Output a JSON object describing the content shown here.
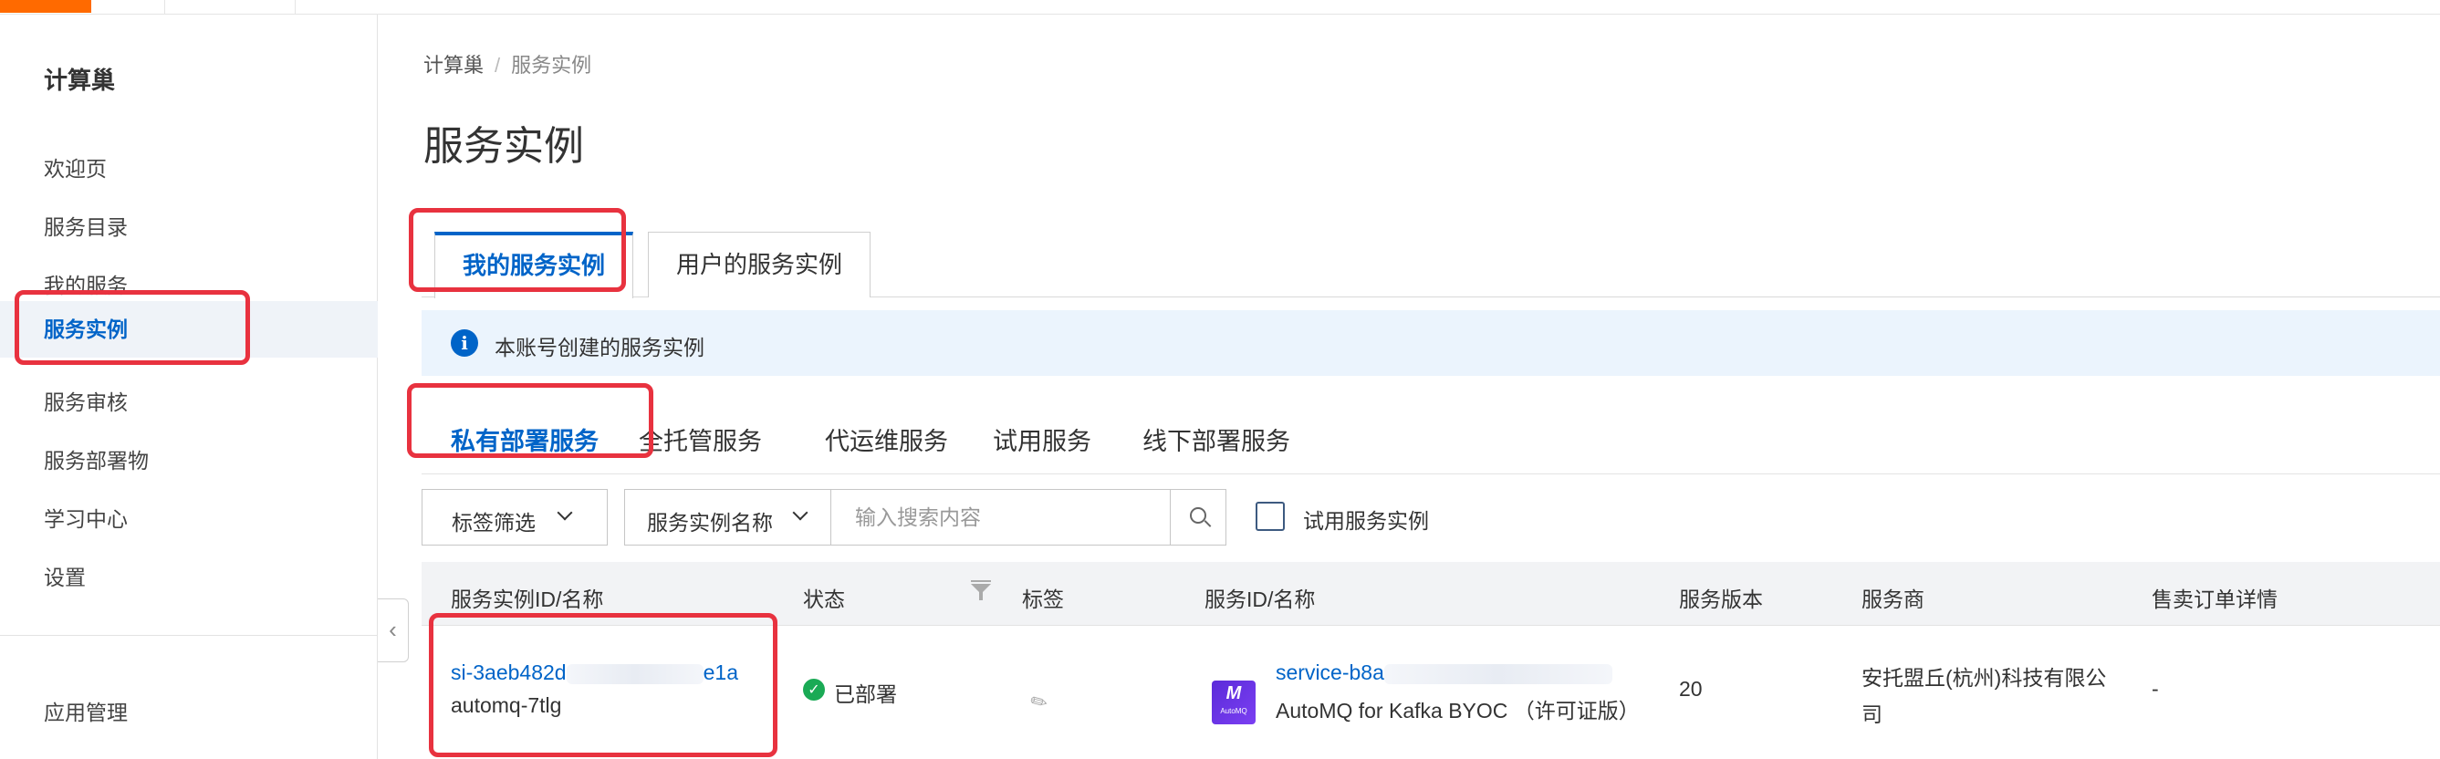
{
  "sidebar": {
    "title": "计算巢",
    "items": [
      {
        "label": "欢迎页"
      },
      {
        "label": "服务目录"
      },
      {
        "label": "我的服务"
      },
      {
        "label": "服务实例"
      },
      {
        "label": "服务审核"
      },
      {
        "label": "服务部署物"
      },
      {
        "label": "学习中心"
      },
      {
        "label": "设置"
      }
    ],
    "bottom_item": "应用管理",
    "active_item": "服务实例"
  },
  "breadcrumb": {
    "items": [
      "计算巢",
      "服务实例"
    ],
    "separator": "/"
  },
  "page_title": "服务实例",
  "tabs": [
    {
      "label": "我的服务实例",
      "active": true
    },
    {
      "label": "用户的服务实例",
      "active": false
    }
  ],
  "info": {
    "icon": "info-icon",
    "text": "本账号创建的服务实例"
  },
  "subtabs": [
    {
      "label": "私有部署服务",
      "active": true
    },
    {
      "label": "全托管服务",
      "active": false
    },
    {
      "label": "代运维服务",
      "active": false
    },
    {
      "label": "试用服务",
      "active": false
    },
    {
      "label": "线下部署服务",
      "active": false
    }
  ],
  "toolbar": {
    "tag_filter_label": "标签筛选",
    "field_select_label": "服务实例名称",
    "search_placeholder": "输入搜索内容",
    "trial_checkbox_label": "试用服务实例"
  },
  "table": {
    "columns": [
      "服务实例ID/名称",
      "状态",
      "标签",
      "服务ID/名称",
      "服务版本",
      "服务商",
      "售卖订单详情"
    ],
    "rows": [
      {
        "instance_id_start": "si-3aeb482d",
        "instance_id_end": "e1a",
        "instance_name": "automq-7tlg",
        "status": "已部署",
        "service_id_start": "service-b8a",
        "service_name": "AutoMQ for Kafka BYOC （许可证版）",
        "service_logo_text": "AutoMQ",
        "service_version": "20",
        "provider_line1": "安托盟丘(杭州)科技有限公",
        "provider_line2": "司",
        "order_details": "-"
      }
    ]
  },
  "colors": {
    "accent": "#0064c8",
    "highlight": "#e8323f",
    "status_ok": "#1aaa55",
    "info_bg": "#ebf4fd"
  }
}
